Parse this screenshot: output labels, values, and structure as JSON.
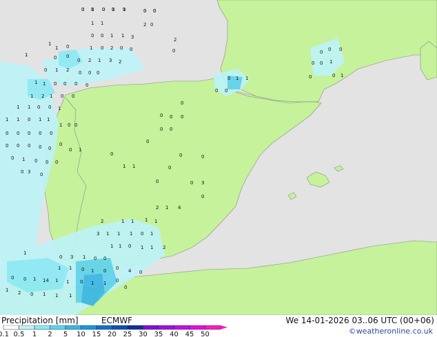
{
  "title": "Precipitation [mm]",
  "model": "ECMWF",
  "run_time": "We 14-01-2026 03..06 UTC (00+06)",
  "credit": "©weatheronline.co.uk",
  "colors": {
    "sea": "#e3e3e3",
    "land": "#c5f29a",
    "border": "#999999",
    "scale": [
      "#ffffff",
      "#bdf3f8",
      "#8aeaf5",
      "#5fd2ef",
      "#37b5e6",
      "#1896e0",
      "#1070d0",
      "#0a4fba",
      "#0a2fa0",
      "#7a10d8",
      "#a010e0",
      "#c010e0",
      "#e010e0",
      "#f020c0"
    ]
  },
  "scale_ticks": [
    "0.1",
    "0.5",
    "1",
    "2",
    "5",
    "10",
    "15",
    "20",
    "25",
    "30",
    "35",
    "40",
    "45",
    "50"
  ],
  "map_values": [
    "0",
    "0",
    "0",
    "1",
    "0",
    "0",
    "0",
    "1",
    "1",
    "2",
    "0",
    "0",
    "0",
    "1",
    "1",
    "3",
    "2",
    "1",
    "0",
    "2",
    "0",
    "0",
    "0",
    "1",
    "1",
    "0",
    "0",
    "2",
    "1",
    "3",
    "2",
    "1",
    "0",
    "0",
    "0",
    "1",
    "2",
    "0",
    "0",
    "0",
    "1",
    "1",
    "0",
    "0",
    "0",
    "0",
    "0",
    "1",
    "1",
    "0",
    "0",
    "0",
    "0",
    "0",
    "1",
    "0",
    "0",
    "0",
    "0",
    "1",
    "1",
    "2",
    "1",
    "0",
    "0",
    "1",
    "1",
    "0",
    "0",
    "1",
    "1",
    "1",
    "0",
    "1",
    "1",
    "1",
    "0",
    "0",
    "0",
    "0",
    "0",
    "0",
    "0",
    "0",
    "0",
    "1",
    "0",
    "0",
    "0",
    "0",
    "0",
    "0",
    "1",
    "0",
    "0",
    "0",
    "0",
    "0",
    "0",
    "0",
    "0",
    "0",
    "0",
    "1",
    "1",
    "0",
    "0",
    "0",
    "0",
    "0",
    "3",
    "0",
    "0",
    "3",
    "0",
    "0",
    "2",
    "1",
    "4",
    "1",
    "2",
    "1",
    "1",
    "1",
    "3",
    "1",
    "1",
    "1",
    "0",
    "1",
    "1",
    "1",
    "0",
    "1",
    "1",
    "2",
    "1",
    "0",
    "3",
    "1",
    "0",
    "0",
    "1",
    "1",
    "0",
    "1",
    "0",
    "0",
    "4",
    "0",
    "0",
    "0",
    "1",
    "14",
    "1",
    "1",
    "0",
    "1",
    "1",
    "0",
    "0",
    "1",
    "2",
    "0",
    "1",
    "1",
    "1",
    "0",
    "1",
    "0",
    "0",
    "1",
    "0",
    "0"
  ]
}
